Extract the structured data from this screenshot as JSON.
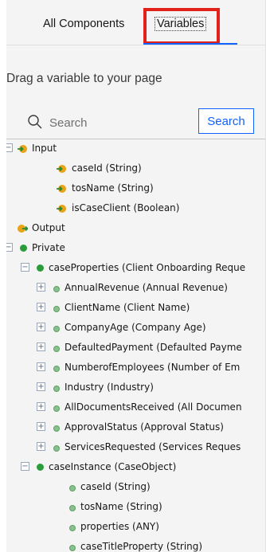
{
  "tabs": {
    "all_components": "All Components",
    "variables": "Variables"
  },
  "instructions": "Drag a variable to your page",
  "search": {
    "placeholder": "Search",
    "button_label": "Search"
  },
  "tree": {
    "input": {
      "label": "Input",
      "children": [
        "caseId (String)",
        "tosName (String)",
        "isCaseClient (Boolean)"
      ]
    },
    "output": {
      "label": "Output"
    },
    "private": {
      "label": "Private",
      "case_properties": {
        "label": "caseProperties (Client Onboarding Reque",
        "children": [
          "AnnualRevenue (Annual Revenue)",
          "ClientName (Client Name)",
          "CompanyAge (Company Age)",
          "DefaultedPayment (Defaulted Payme",
          "NumberofEmployees (Number of Em",
          "Industry (Industry)",
          "AllDocumentsReceived (All Documen",
          "ApprovalStatus (Approval Status)",
          "ServicesRequested (Services Reques"
        ]
      },
      "case_instance": {
        "label": "caseInstance (CaseObject)",
        "children": [
          "caseId (String)",
          "tosName (String)",
          "properties (ANY)",
          "caseTitleProperty (String)"
        ]
      }
    },
    "expander_symbols": {
      "expanded": "−",
      "collapsed": "+"
    }
  }
}
